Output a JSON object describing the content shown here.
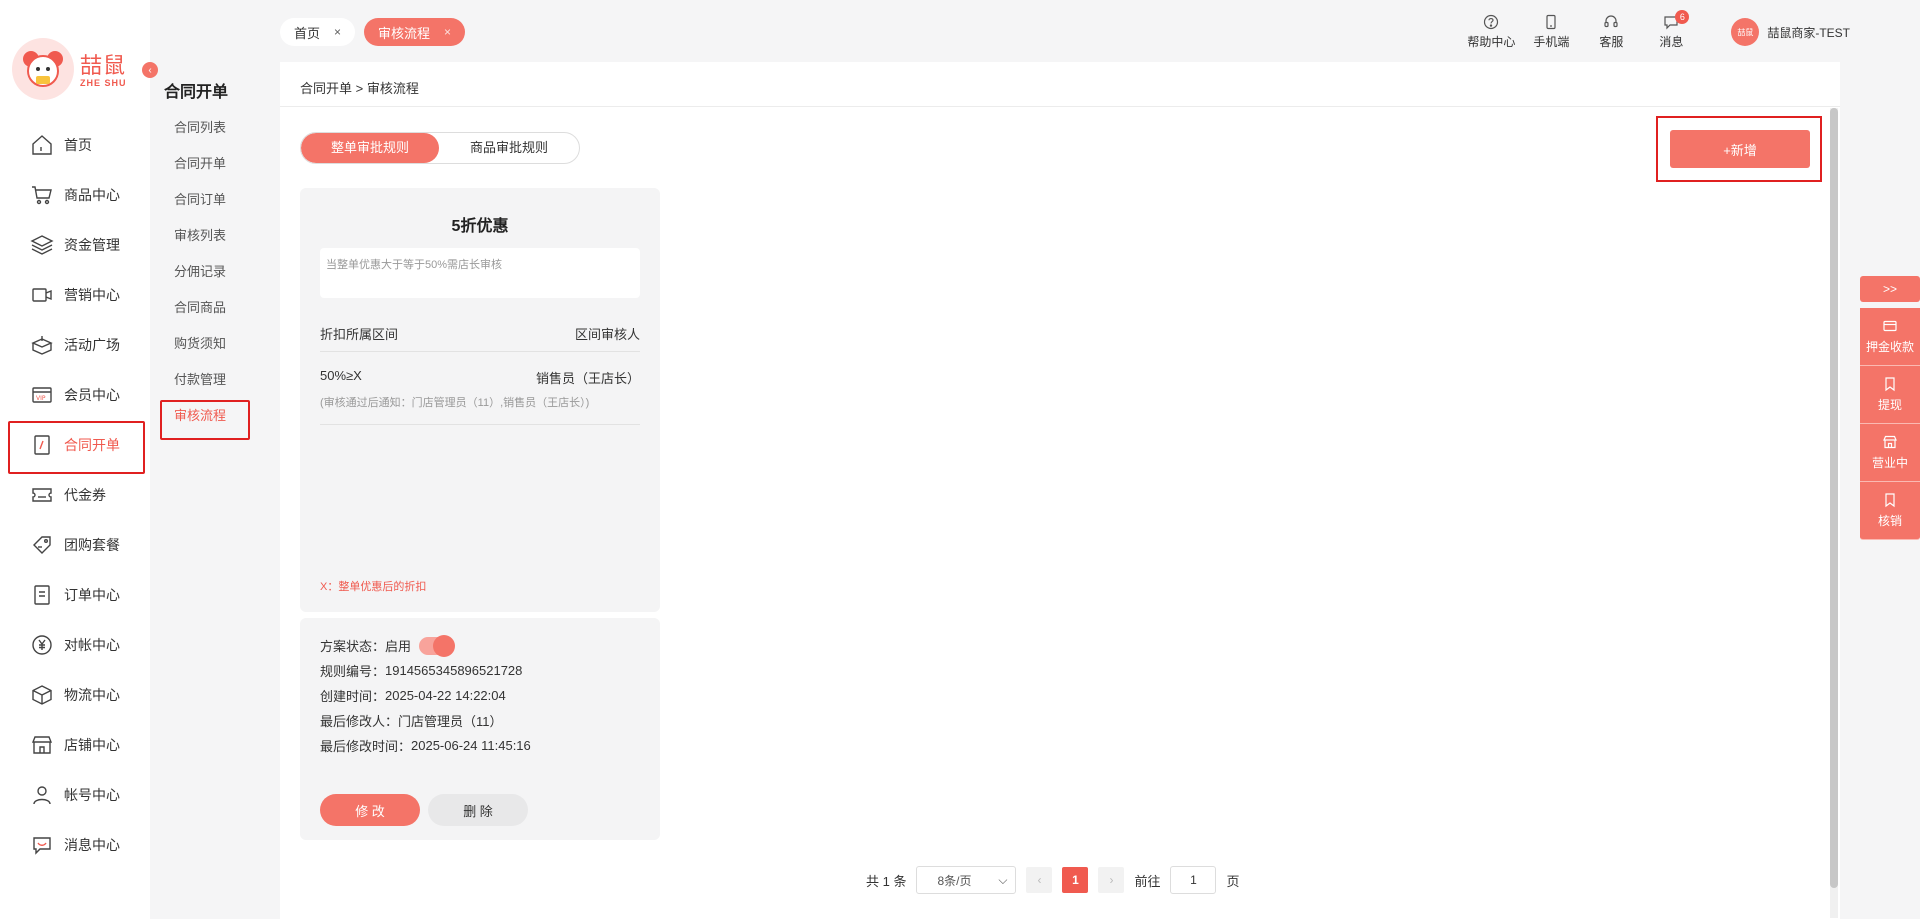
{
  "brand": {
    "name": "喆鼠",
    "sub": "ZHE SHU"
  },
  "nav": [
    {
      "label": "首页",
      "icon": "home-icon"
    },
    {
      "label": "商品中心",
      "icon": "cart-icon"
    },
    {
      "label": "资金管理",
      "icon": "layers-icon"
    },
    {
      "label": "营销中心",
      "icon": "marketing-icon"
    },
    {
      "label": "活动广场",
      "icon": "box-icon"
    },
    {
      "label": "会员中心",
      "icon": "vip-icon"
    },
    {
      "label": "合同开单",
      "icon": "contract-icon"
    },
    {
      "label": "代金券",
      "icon": "ticket-icon"
    },
    {
      "label": "团购套餐",
      "icon": "tag-icon"
    },
    {
      "label": "订单中心",
      "icon": "order-icon"
    },
    {
      "label": "对帐中心",
      "icon": "yen-icon"
    },
    {
      "label": "物流中心",
      "icon": "package-icon"
    },
    {
      "label": "店铺中心",
      "icon": "shop-icon"
    },
    {
      "label": "帐号中心",
      "icon": "user-icon"
    },
    {
      "label": "消息中心",
      "icon": "message-icon"
    }
  ],
  "submenu": {
    "title": "合同开单",
    "items": [
      "合同列表",
      "合同开单",
      "合同订单",
      "审核列表",
      "分佣记录",
      "合同商品",
      "购货须知",
      "付款管理",
      "审核流程"
    ]
  },
  "tabs": [
    {
      "label": "首页",
      "close": "×"
    },
    {
      "label": "审核流程",
      "close": "×"
    }
  ],
  "top_actions": [
    {
      "label": "帮助中心",
      "icon": "help-icon"
    },
    {
      "label": "手机端",
      "icon": "mobile-icon"
    },
    {
      "label": "客服",
      "icon": "headset-icon"
    },
    {
      "label": "消息",
      "icon": "chat-icon",
      "badge": "6"
    }
  ],
  "user": {
    "avatar_text": "喆鼠",
    "name": "喆鼠商家-TEST"
  },
  "breadcrumb": "合同开单  > 审核流程",
  "segments": [
    "整单审批规则",
    "商品审批规则"
  ],
  "add_button": "+新增",
  "rule": {
    "title": "5折优惠",
    "desc": "当整单优惠大于等于50%需店长审核",
    "col_range": "折扣所属区间",
    "col_reviewer": "区间审核人",
    "range": "50%≥X",
    "reviewer": "销售员（王店长）",
    "notify": "(审核通过后通知：门店管理员（11）,销售员（王店长）)",
    "x_note": "X：整单优惠后的折扣"
  },
  "info": {
    "status_label": "方案状态：",
    "status_value": "启用",
    "code_label": "规则编号：",
    "code_value": "1914565345896521728",
    "created_label": "创建时间：",
    "created_value": "2025-04-22 14:22:04",
    "modifier_label": "最后修改人：",
    "modifier_value": "门店管理员（11）",
    "modified_label": "最后修改时间：",
    "modified_value": "2025-06-24 11:45:16",
    "edit_button": "修 改",
    "delete_button": "删 除"
  },
  "pagination": {
    "total": "共 1 条",
    "page_size": "8条/页",
    "current_page": "1",
    "goto_label": "前往",
    "goto_value": "1",
    "page_suffix": "页"
  },
  "float_panel": {
    "toggle": ">>",
    "items": [
      {
        "label": "押金收款",
        "icon": "card-icon"
      },
      {
        "label": "提现",
        "icon": "bookmark-icon"
      },
      {
        "label": "营业中",
        "icon": "store-icon"
      },
      {
        "label": "核销",
        "icon": "bookmark-icon"
      }
    ]
  },
  "colors": {
    "accent": "#f47468",
    "highlight_border": "#e02020"
  }
}
